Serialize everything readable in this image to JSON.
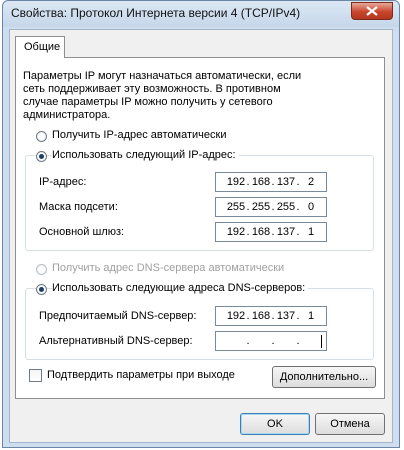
{
  "window": {
    "title": "Свойства: Протокол Интернета версии 4 (TCP/IPv4)",
    "close_label": "close"
  },
  "tabs": [
    {
      "label": "Общие",
      "active": true
    }
  ],
  "description": "Параметры IP могут назначаться автоматически, если сеть поддерживает эту возможность. В противном случае параметры IP можно получить у сетевого администратора.",
  "ip_section": {
    "auto_label": "Получить IP-адрес автоматически",
    "auto_selected": false,
    "manual_label": "Использовать следующий IP-адрес:",
    "manual_selected": true,
    "fields": [
      {
        "label": "IP-адрес:",
        "octets": [
          "192",
          "168",
          "137",
          "2"
        ]
      },
      {
        "label": "Маска подсети:",
        "octets": [
          "255",
          "255",
          "255",
          "0"
        ]
      },
      {
        "label": "Основной шлюз:",
        "octets": [
          "192",
          "168",
          "137",
          "1"
        ]
      }
    ]
  },
  "dns_section": {
    "auto_label": "Получить адрес DNS-сервера автоматически",
    "auto_selected": false,
    "auto_disabled": true,
    "manual_label": "Использовать следующие адреса DNS-серверов:",
    "manual_selected": true,
    "fields": [
      {
        "label": "Предпочитаемый DNS-сервер:",
        "octets": [
          "192",
          "168",
          "137",
          "1"
        ]
      },
      {
        "label": "Альтернативный DNS-сервер:",
        "octets": [
          "",
          "",
          "",
          ""
        ]
      }
    ]
  },
  "confirm_checkbox": {
    "label": "Подтвердить параметры при выходе",
    "checked": false
  },
  "buttons": {
    "advanced": "Дополнительно...",
    "ok": "OK",
    "cancel": "Отмена"
  },
  "colors": {
    "frame": "#cfdeee",
    "close_button": "#c9452c",
    "panel": "#f0f0f0"
  }
}
